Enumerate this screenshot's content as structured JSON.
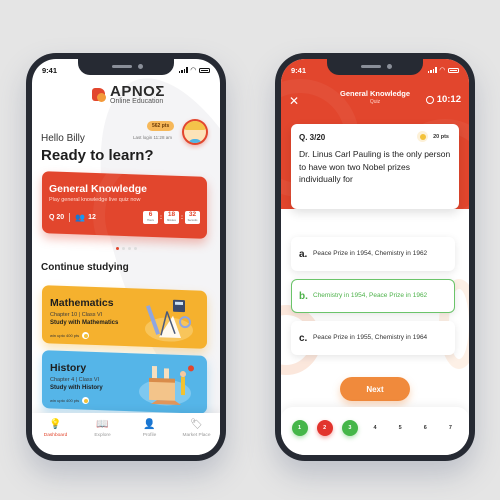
{
  "left_phone": {
    "status": {
      "time": "9:41"
    },
    "logo": {
      "title": "ΑΡΝΟΣ",
      "subtitle": "Online Education"
    },
    "profile": {
      "points": "562 pts",
      "last_login": "Last login 11:28 am"
    },
    "greeting": "Hello Billy",
    "headline": "Ready to learn?",
    "live_quiz": {
      "title": "General Knowledge",
      "subtitle": "Play general knowledge live quiz now",
      "questions": "Q 20",
      "participants": "12",
      "timer": [
        {
          "value": "6",
          "label": "Hours"
        },
        {
          "value": "18",
          "label": "Minutes"
        },
        {
          "value": "32",
          "label": "Seconds"
        }
      ],
      "carousel_active_index": 0,
      "carousel_count": 4
    },
    "continue_heading": "Continue studying",
    "courses": [
      {
        "title": "Mathematics",
        "meta": "Chapter 10  |  Class VI",
        "cta": "Study with Mathematics",
        "reward": "win upto 400 pts",
        "color": "#f5b12e"
      },
      {
        "title": "History",
        "meta": "Chapter 4  |  Class VI",
        "cta": "Study with History",
        "reward": "win upto 400 pts",
        "color": "#55b5e8"
      }
    ],
    "tabs": [
      {
        "label": "Dashboard",
        "icon": "lightbulb-icon",
        "active": true
      },
      {
        "label": "Explore",
        "icon": "book-icon",
        "active": false
      },
      {
        "label": "Profile",
        "icon": "user-icon",
        "active": false
      },
      {
        "label": "Market Place",
        "icon": "tag-icon",
        "active": false
      }
    ]
  },
  "right_phone": {
    "status": {
      "time": "9:41"
    },
    "header": {
      "title": "General Knowledge",
      "subtitle": "Quiz",
      "timer": "10:12"
    },
    "question": {
      "number": "Q. 3/20",
      "points": "20 pts",
      "text": "Dr. Linus Carl Pauling is the only person to have won two Nobel prizes individually for"
    },
    "options": [
      {
        "letter": "a.",
        "text": "Peace Prize in 1954, Chemistry in 1962",
        "selected": false
      },
      {
        "letter": "b.",
        "text": "Chemistry in 1954, Peace Prize in 1962",
        "selected": true
      },
      {
        "letter": "c.",
        "text": "Peace Prize in 1955, Chemistry in 1964",
        "selected": false
      }
    ],
    "next_label": "Next",
    "question_nav": [
      {
        "label": "1",
        "state": "correct"
      },
      {
        "label": "2",
        "state": "wrong"
      },
      {
        "label": "3",
        "state": "correct"
      },
      {
        "label": "4",
        "state": "pending"
      },
      {
        "label": "5",
        "state": "pending"
      },
      {
        "label": "6",
        "state": "pending"
      },
      {
        "label": "7",
        "state": "pending"
      }
    ]
  },
  "colors": {
    "primary": "#e2462d",
    "accent_orange": "#f08a3c",
    "correct": "#45b649",
    "math": "#f5b12e",
    "history": "#55b5e8"
  }
}
